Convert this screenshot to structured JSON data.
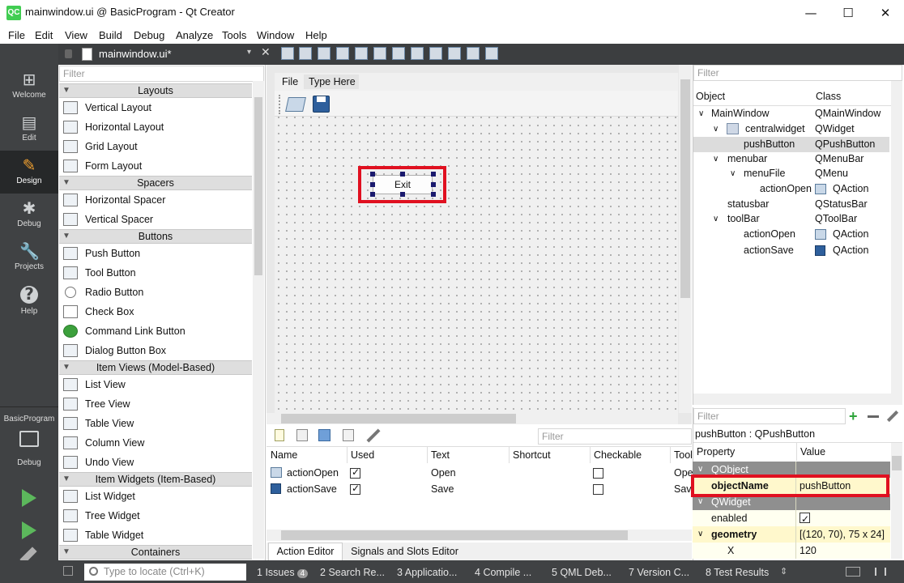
{
  "window": {
    "title": "mainwindow.ui @ BasicProgram - Qt Creator",
    "logo": "QC",
    "min_glyph": "—",
    "max_glyph": "☐",
    "close_glyph": "✕"
  },
  "menu": [
    "File",
    "Edit",
    "View",
    "Build",
    "Debug",
    "Analyze",
    "Tools",
    "Window",
    "Help"
  ],
  "modes": [
    {
      "label": "Welcome",
      "icon": "⊞"
    },
    {
      "label": "Edit",
      "icon": "▤"
    },
    {
      "label": "Design",
      "icon": "✎"
    },
    {
      "label": "Debug",
      "icon": "✱"
    },
    {
      "label": "Projects",
      "icon": "🔧"
    },
    {
      "label": "Help",
      "icon": "?"
    }
  ],
  "project": {
    "name": "BasicProgram",
    "kit": "Debug"
  },
  "editor": {
    "document": "mainwindow.ui*",
    "close": "✕"
  },
  "widgetbox": {
    "filter": "Filter",
    "layouts": {
      "title": "Layouts",
      "items": [
        "Vertical Layout",
        "Horizontal Layout",
        "Grid Layout",
        "Form Layout"
      ]
    },
    "spacers": {
      "title": "Spacers",
      "items": [
        "Horizontal Spacer",
        "Vertical Spacer"
      ]
    },
    "buttons": {
      "title": "Buttons",
      "items": [
        "Push Button",
        "Tool Button",
        "Radio Button",
        "Check Box",
        "Command Link Button",
        "Dialog Button Box"
      ]
    },
    "itemviews": {
      "title": "Item Views (Model-Based)",
      "items": [
        "List View",
        "Tree View",
        "Table View",
        "Column View",
        "Undo View"
      ]
    },
    "itemwidgets": {
      "title": "Item Widgets (Item-Based)",
      "items": [
        "List Widget",
        "Tree Widget",
        "Table Widget"
      ]
    },
    "containers": {
      "title": "Containers"
    }
  },
  "form": {
    "menu": [
      "File",
      "Type Here"
    ],
    "button_text": "Exit"
  },
  "actioneditor": {
    "filter": "Filter",
    "columns": [
      "Name",
      "Used",
      "Text",
      "Shortcut",
      "Checkable",
      "Tool"
    ],
    "rows": [
      {
        "name": "actionOpen",
        "used": true,
        "text": "Open",
        "checkable": false,
        "tooltip": "Ope"
      },
      {
        "name": "actionSave",
        "used": true,
        "text": "Save",
        "checkable": false,
        "tooltip": "Sav"
      }
    ],
    "tabs": [
      "Action Editor",
      "Signals and Slots Editor"
    ]
  },
  "objectinspector": {
    "filter": "Filter",
    "columns": [
      "Object",
      "Class"
    ],
    "rows": [
      {
        "object": "MainWindow",
        "class": "QMainWindow",
        "arrow": "∨"
      },
      {
        "object": "centralwidget",
        "class": "QWidget",
        "arrow": "∨"
      },
      {
        "object": "pushButton",
        "class": "QPushButton",
        "arrow": ""
      },
      {
        "object": "menubar",
        "class": "QMenuBar",
        "arrow": "∨"
      },
      {
        "object": "menuFile",
        "class": "QMenu",
        "arrow": "∨"
      },
      {
        "object": "actionOpen",
        "class": "QAction",
        "arrow": ""
      },
      {
        "object": "statusbar",
        "class": "QStatusBar",
        "arrow": ""
      },
      {
        "object": "toolBar",
        "class": "QToolBar",
        "arrow": "∨"
      },
      {
        "object": "actionOpen",
        "class": "QAction",
        "arrow": ""
      },
      {
        "object": "actionSave",
        "class": "QAction",
        "arrow": ""
      }
    ]
  },
  "propertyeditor": {
    "filter": "Filter",
    "context": "pushButton : QPushButton",
    "columns": [
      "Property",
      "Value"
    ],
    "qobject": "QObject",
    "objectName_label": "objectName",
    "objectName_value": "pushButton",
    "qwidget": "QWidget",
    "enabled_label": "enabled",
    "geometry_label": "geometry",
    "geometry_value": "[(120, 70), 75 x 24]",
    "x_label": "X",
    "x_value": "120"
  },
  "statusbar": {
    "locate_placeholder": "Type to locate (Ctrl+K)",
    "tabs": [
      {
        "n": "1",
        "label": "Issues",
        "badge": "4"
      },
      {
        "n": "2",
        "label": "Search Re..."
      },
      {
        "n": "3",
        "label": "Applicatio..."
      },
      {
        "n": "4",
        "label": "Compile ..."
      },
      {
        "n": "5",
        "label": "QML Deb..."
      },
      {
        "n": "7",
        "label": "Version C..."
      },
      {
        "n": "8",
        "label": "Test Results"
      }
    ]
  }
}
